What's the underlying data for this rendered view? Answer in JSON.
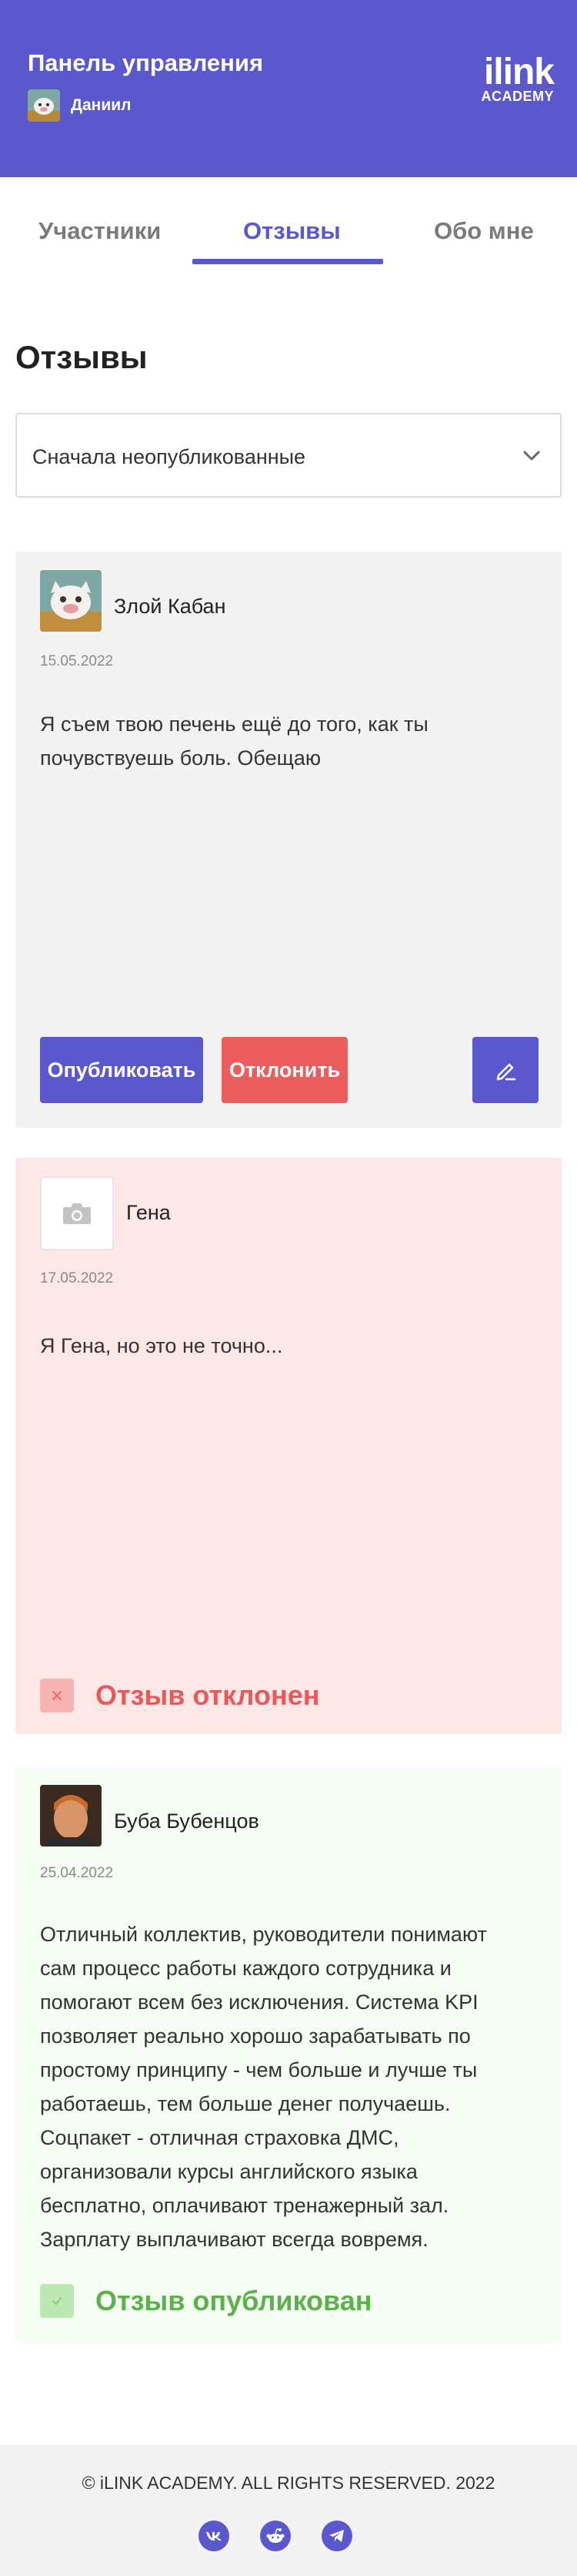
{
  "header": {
    "title": "Панель управления",
    "user_name": "Даниил",
    "logo_main": "ilink",
    "logo_sub": "ACADEMY",
    "background_color": "#5a58cc"
  },
  "tabs": [
    {
      "label": "Участники",
      "active": false
    },
    {
      "label": "Отзывы",
      "active": true
    },
    {
      "label": "Обо мне",
      "active": false
    }
  ],
  "section": {
    "title": "Отзывы",
    "sort_value": "Сначала неопубликованные"
  },
  "reviews": [
    {
      "author": "Злой Кабан",
      "date": "15.05.2022",
      "text": "Я съем твою печень ещё до того, как ты почувствуешь боль. Обещаю",
      "status": "pending",
      "publish_label": "Опубликовать",
      "reject_label": "Отклонить",
      "edit_icon": "pencil-icon"
    },
    {
      "author": "Гена",
      "date": "17.05.2022",
      "text": "Я Гена, но это не точно...",
      "status": "rejected",
      "status_label": "Отзыв отклонен",
      "status_color": "#e85a5a"
    },
    {
      "author": "Буба Бубенцов",
      "date": "25.04.2022",
      "text": "Отличный коллектив, руководители понимают сам процесс работы каждого сотрудника и помогают всем без исключения. Система KPI позволяет реально хорошо зарабатывать по простому принципу - чем больше и лучше ты работаешь, тем больше денег получаешь. Соцпакет - отличная страховка ДМС, организовали курсы английского языка бесплатно, оплачивают тренажерный зал. Зарплату выплачивают всегда вовремя.",
      "status": "published",
      "status_label": "Отзыв опубликован",
      "status_color": "#5bb24a"
    }
  ],
  "footer": {
    "copyright": "© iLINK ACADEMY. ALL RIGHTS RESERVED. 2022",
    "socials": [
      "vk-icon",
      "reddit-icon",
      "telegram-icon"
    ]
  }
}
